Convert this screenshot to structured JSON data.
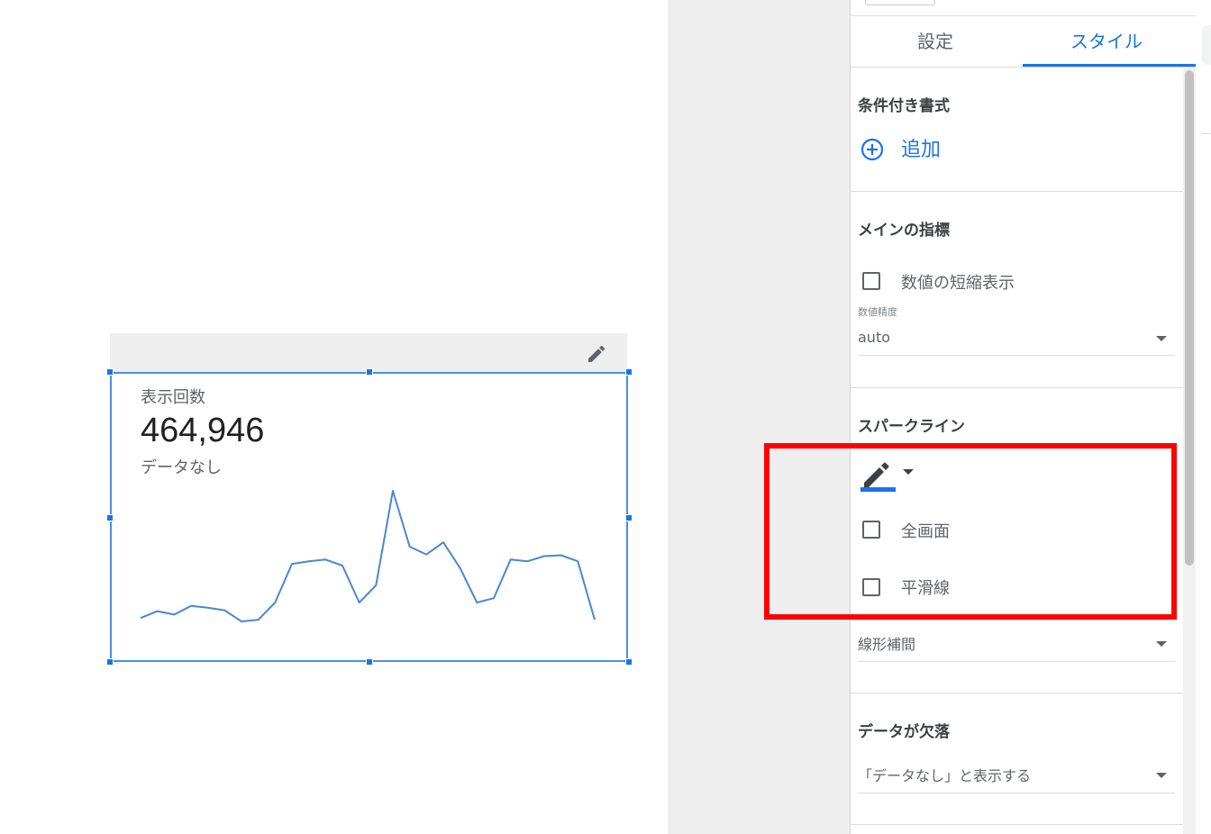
{
  "scorecard": {
    "label": "表示回数",
    "value": "464,946",
    "comparison": "データなし"
  },
  "sparkline_color": "#4a86d4",
  "chart_data": {
    "type": "line",
    "series": [
      {
        "values": [
          1.2,
          2.0,
          1.6,
          2.6,
          2.4,
          2.1,
          0.8,
          1.0,
          3.0,
          7.5,
          7.8,
          8.0,
          7.3,
          3.0,
          5.0,
          16.0,
          9.5,
          8.6,
          10.0,
          7.0,
          3.0,
          3.5,
          8.0,
          7.8,
          8.4,
          8.5,
          7.8,
          1.0
        ]
      }
    ]
  },
  "panel": {
    "tabs": [
      {
        "label": "設定"
      },
      {
        "label": "スタイル"
      }
    ],
    "active_tab": "スタイル",
    "conditional": {
      "title": "条件付き書式",
      "add_label": "追加"
    },
    "main_metric": {
      "title": "メインの指標",
      "compact_label": "数値の短縮表示",
      "precision_label": "数値精度",
      "precision_value": "auto"
    },
    "sparkline": {
      "title": "スパークライン",
      "fill_label": "全画面",
      "smooth_label": "平滑線",
      "interpolation_value": "線形補間"
    },
    "missing_data": {
      "title": "データが欠落",
      "value": "「データなし」と表示する"
    }
  },
  "colors": {
    "accent": "#1a73e8",
    "highlight": "#ff0000"
  }
}
